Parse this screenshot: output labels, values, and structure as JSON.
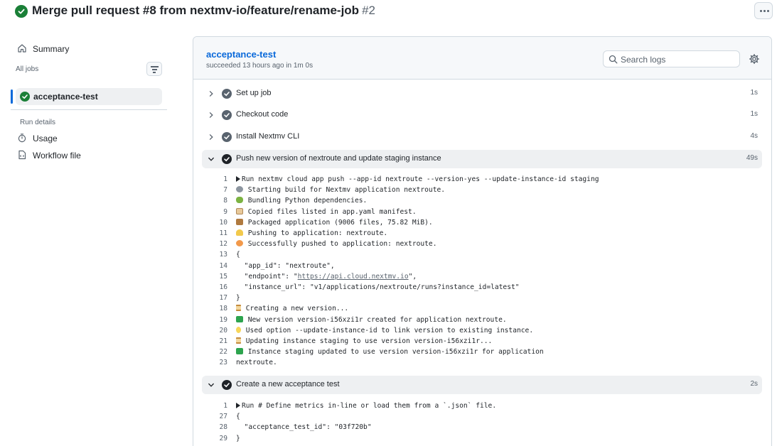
{
  "header": {
    "title": "Merge pull request #8 from nextmv-io/feature/rename-job",
    "run_number": "#2"
  },
  "sidebar": {
    "summary_label": "Summary",
    "all_jobs_label": "All jobs",
    "jobs": [
      {
        "label": "acceptance-test",
        "status": "success"
      }
    ],
    "run_details_label": "Run details",
    "usage_label": "Usage",
    "workflow_file_label": "Workflow file"
  },
  "job": {
    "title": "acceptance-test",
    "subtitle": "succeeded 13 hours ago in 1m 0s",
    "search_placeholder": "Search logs"
  },
  "steps": [
    {
      "label": "Set up job",
      "time": "1s",
      "expanded": false
    },
    {
      "label": "Checkout code",
      "time": "1s",
      "expanded": false
    },
    {
      "label": "Install Nextmv CLI",
      "time": "4s",
      "expanded": false
    },
    {
      "label": "Push new version of nextroute and update staging instance",
      "time": "49s",
      "expanded": true
    },
    {
      "label": "Create a new acceptance test",
      "time": "2s",
      "expanded": true
    }
  ],
  "log_push": [
    {
      "n": "1",
      "icon": "play",
      "text": "Run nextmv cloud app push --app-id nextroute --version-yes --update-instance-id staging"
    },
    {
      "n": "7",
      "icon": "gear",
      "text": " Starting build for Nextmv application nextroute."
    },
    {
      "n": "8",
      "icon": "snake",
      "text": " Bundling Python dependencies."
    },
    {
      "n": "9",
      "icon": "clip",
      "text": " Copied files listed in app.yaml manifest."
    },
    {
      "n": "10",
      "icon": "box",
      "text": " Packaged application (9006 files, 75.82 MiB)."
    },
    {
      "n": "11",
      "icon": "wave",
      "text": " Pushing to application: nextroute."
    },
    {
      "n": "12",
      "icon": "boom",
      "text": " Successfully pushed to application: nextroute."
    },
    {
      "n": "13",
      "icon": "",
      "text": "{"
    },
    {
      "n": "14",
      "icon": "",
      "text": "  \"app_id\": \"nextroute\","
    },
    {
      "n": "15",
      "icon": "",
      "text": "  \"endpoint\": \"",
      "url": "https://api.cloud.nextmv.io",
      "after": "\","
    },
    {
      "n": "16",
      "icon": "",
      "text": "  \"instance_url\": \"v1/applications/nextroute/runs?instance_id=latest\""
    },
    {
      "n": "17",
      "icon": "",
      "text": "}"
    },
    {
      "n": "18",
      "icon": "hourglass",
      "text": " Creating a new version..."
    },
    {
      "n": "19",
      "icon": "check",
      "text": " New version version-i56xzi1r created for application nextroute."
    },
    {
      "n": "20",
      "icon": "bulb",
      "text": " Used option --update-instance-id to link version to existing instance."
    },
    {
      "n": "21",
      "icon": "hourglass",
      "text": " Updating instance staging to use version version-i56xzi1r..."
    },
    {
      "n": "22",
      "icon": "check",
      "text": " Instance staging updated to use version version-i56xzi1r for application"
    },
    {
      "n": "23",
      "icon": "",
      "text": "nextroute."
    }
  ],
  "log_accept": [
    {
      "n": "1",
      "icon": "play",
      "text": "Run # Define metrics in-line or load them from a `.json` file."
    },
    {
      "n": "27",
      "icon": "",
      "text": "{"
    },
    {
      "n": "28",
      "icon": "",
      "text": "  \"acceptance_test_id\": \"03f720b\""
    },
    {
      "n": "29",
      "icon": "",
      "text": "}"
    }
  ],
  "colors": {
    "success": "#1a7f37",
    "link": "#0969da",
    "muted": "#59636e",
    "border": "#d1d9e0"
  }
}
